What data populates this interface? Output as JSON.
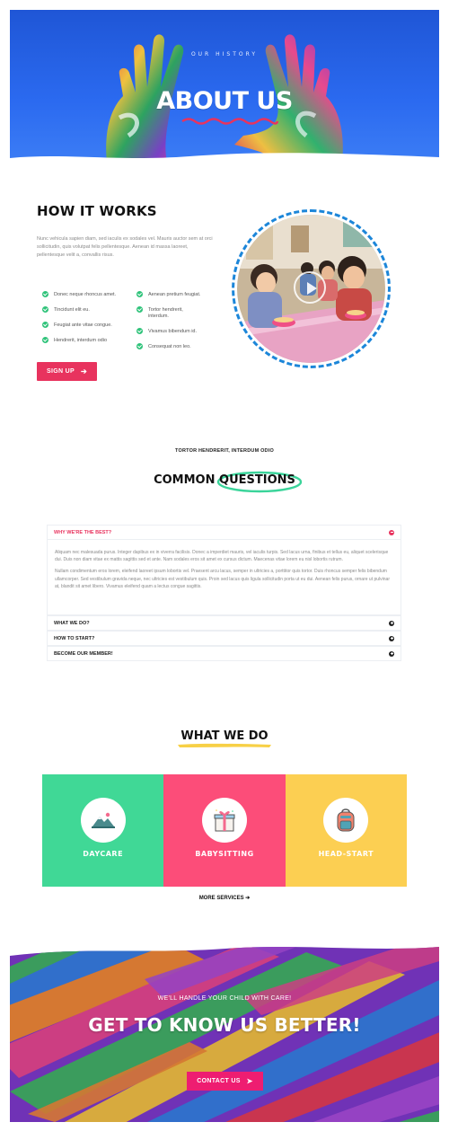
{
  "hero": {
    "eyebrow": "OUR HISTORY",
    "title": "ABOUT US"
  },
  "how_it_works": {
    "title": "HOW IT WORKS",
    "text": "Nunc vehicula sapien diam, sed iaculis ex sodales vel. Mauris auctor sem at orci sollicitudin, quis volutpat felis pellentesque. Aenean id massa laoreet, pellentesque velit a, convallis risus.",
    "features_left": [
      "Donec neque rhoncus amet.",
      "Tincidunt elit eu.",
      "Feugiat ante vitae congue.",
      "Hendrerit, interdum odio"
    ],
    "features_right": [
      "Aenean pretium feugiat.",
      "Tortor hendrerit, interdum.",
      "Vivamus bibendum id.",
      "Consequat non leo."
    ],
    "signup_label": "SIGN UP",
    "arrow_icon": "arrow-right-icon",
    "check_color": "#2fc37a",
    "button_color": "#e8335e",
    "ring_color": "#1c86d9"
  },
  "faq": {
    "eyebrow": "TORTOR HENDRERIT, INTERDUM ODIO",
    "title_a": "COMMON",
    "title_b": "QUESTIONS",
    "items": [
      {
        "question": "WHY WE'RE THE BEST?",
        "open": true,
        "answer_1": "Aliquam nec malesuada purus. Integer dapibus ex in viverra facilisis. Donec a imperdiet mauris, vel iaculis turpis. Sed lacus urna, finibus et tellus eu, aliquet scelerisque dui. Duis non diam vitae ex mattis sagittis sed et ante. Nam sodales eros sit amet ex cursus dictum. Maecenas vitae lorem eu nisl lobortis rutrum.",
        "answer_2": "Nullam condimentum eros lorem, eleifend laoreet ipsum lobortis vel. Praesent arcu lacus, semper in ultricies a, porttitor quis tortor. Duis rhoncus semper felis bibendum ullamcorper. Sed vestibulum gravida neque, nec ultricies est vestibulum quis. Proin sed lacus quis ligula sollicitudin porta ut eu dui. Aenean felis purus, ornare ut pulvinar at, blandit sit amet libero. Vivamus eleifend quam a lectus congue sagittis."
      },
      {
        "question": "WHAT WE DO?",
        "open": false
      },
      {
        "question": "HOW TO START?",
        "open": false
      },
      {
        "question": "BECOME OUR MEMBER!",
        "open": false
      }
    ],
    "highlight_color": "#3ad49a"
  },
  "what_we_do": {
    "title": "WHAT WE DO",
    "underline_color": "#f7d046",
    "services": [
      {
        "label": "DAYCARE",
        "icon": "landscape-icon",
        "color": "#40d896"
      },
      {
        "label": "BABYSITTING",
        "icon": "gift-icon",
        "color": "#fc4d79"
      },
      {
        "label": "HEAD-START",
        "icon": "backpack-icon",
        "color": "#fccf52"
      }
    ],
    "more_label": "MORE SERVICES"
  },
  "cta": {
    "eyebrow": "WE'LL HANDLE YOUR CHILD WITH CARE!",
    "title": "GET TO KNOW US BETTER!",
    "contact_label": "CONTACT US",
    "send_icon": "paper-plane-icon",
    "button_color": "#ee1d71"
  }
}
